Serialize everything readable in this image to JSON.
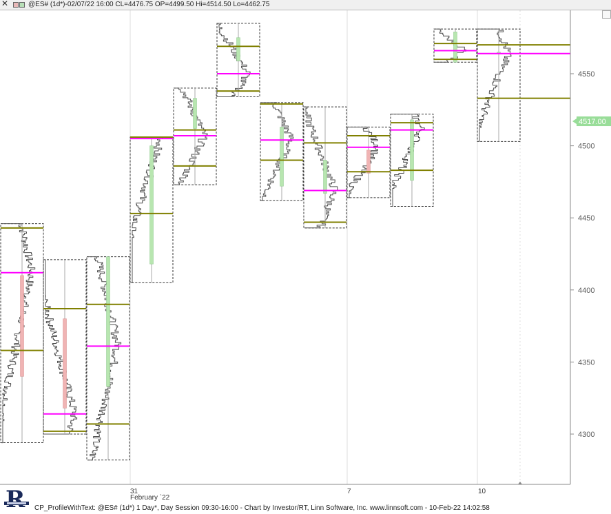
{
  "window": {
    "close_glyph": "✕",
    "title": "@ES# (1d*)-02/07/22 16:00 CL=4476.75 OP=4499.50 Hi=4514.50 Lo=4462.75"
  },
  "footer": {
    "text": "CP_ProfileWithText: @ES# (1d*) 1 Day*, Day Session 09:30-16:00 - Chart by Investor/RT, Linn Software, Inc. www.linnsoft.com - 10-Feb-22 14:02:58",
    "logo_letter": "R"
  },
  "colors": {
    "poc": "#ff00ff",
    "value_area": "#808000",
    "up_body": "#b8e6b0",
    "down_body": "#f0b4b4",
    "profile": "#505050",
    "box": "#333333",
    "grid": "#dddddd",
    "price_marker": "#99dd99"
  },
  "chart_data": {
    "type": "market-profile",
    "y_axis": {
      "ticks": [
        4300,
        4350,
        4400,
        4450,
        4500,
        4550
      ],
      "range": [
        4265,
        4595
      ],
      "side": "right"
    },
    "x_axis": {
      "labels": [
        "31",
        "February `22",
        "7",
        "10"
      ]
    },
    "last_price": 4517.0,
    "last_price_label": "4517.00",
    "sessions": [
      {
        "high": 4446,
        "low": 4294,
        "open": 4410,
        "close": 4340,
        "poc": 4412,
        "vah": 4358,
        "val": 4443
      },
      {
        "high": 4421,
        "low": 4300,
        "open": 4380,
        "close": 4318,
        "poc": 4314,
        "vah": 4387,
        "val": 4302
      },
      {
        "high": 4423,
        "low": 4282,
        "open": 4333,
        "close": 4423,
        "poc": 4361,
        "vah": 4390,
        "val": 4307
      },
      {
        "high": 4506,
        "low": 4405,
        "open": 4418,
        "close": 4500,
        "poc": 4505,
        "vah": 4453,
        "val": 4506
      },
      {
        "high": 4540,
        "low": 4473,
        "open": 4512,
        "close": 4533,
        "poc": 4507,
        "vah": 4511,
        "val": 4486
      },
      {
        "high": 4585,
        "low": 4534,
        "open": 4559,
        "close": 4575,
        "poc": 4550,
        "vah": 4569,
        "val": 4538
      },
      {
        "high": 4530,
        "low": 4462,
        "open": 4472,
        "close": 4513,
        "poc": 4504,
        "vah": 4529,
        "val": 4490
      },
      {
        "high": 4527,
        "low": 4443,
        "open": 4467,
        "close": 4490,
        "poc": 4469,
        "vah": 4502,
        "val": 4447
      },
      {
        "high": 4513,
        "low": 4464,
        "open": 4497,
        "close": 4481,
        "poc": 4499,
        "vah": 4507,
        "val": 4482
      },
      {
        "high": 4522,
        "low": 4458,
        "open": 4476,
        "close": 4518,
        "poc": 4511,
        "vah": 4516,
        "val": 4483
      },
      {
        "high": 4581,
        "low": 4558,
        "open": 4558,
        "close": 4579,
        "poc": 4566,
        "vah": 4571,
        "val": 4560
      },
      {
        "high": 4581,
        "low": 4503,
        "open": 4565,
        "close": 4565,
        "poc": 4564,
        "vah": 4570,
        "val": 4533
      }
    ]
  }
}
